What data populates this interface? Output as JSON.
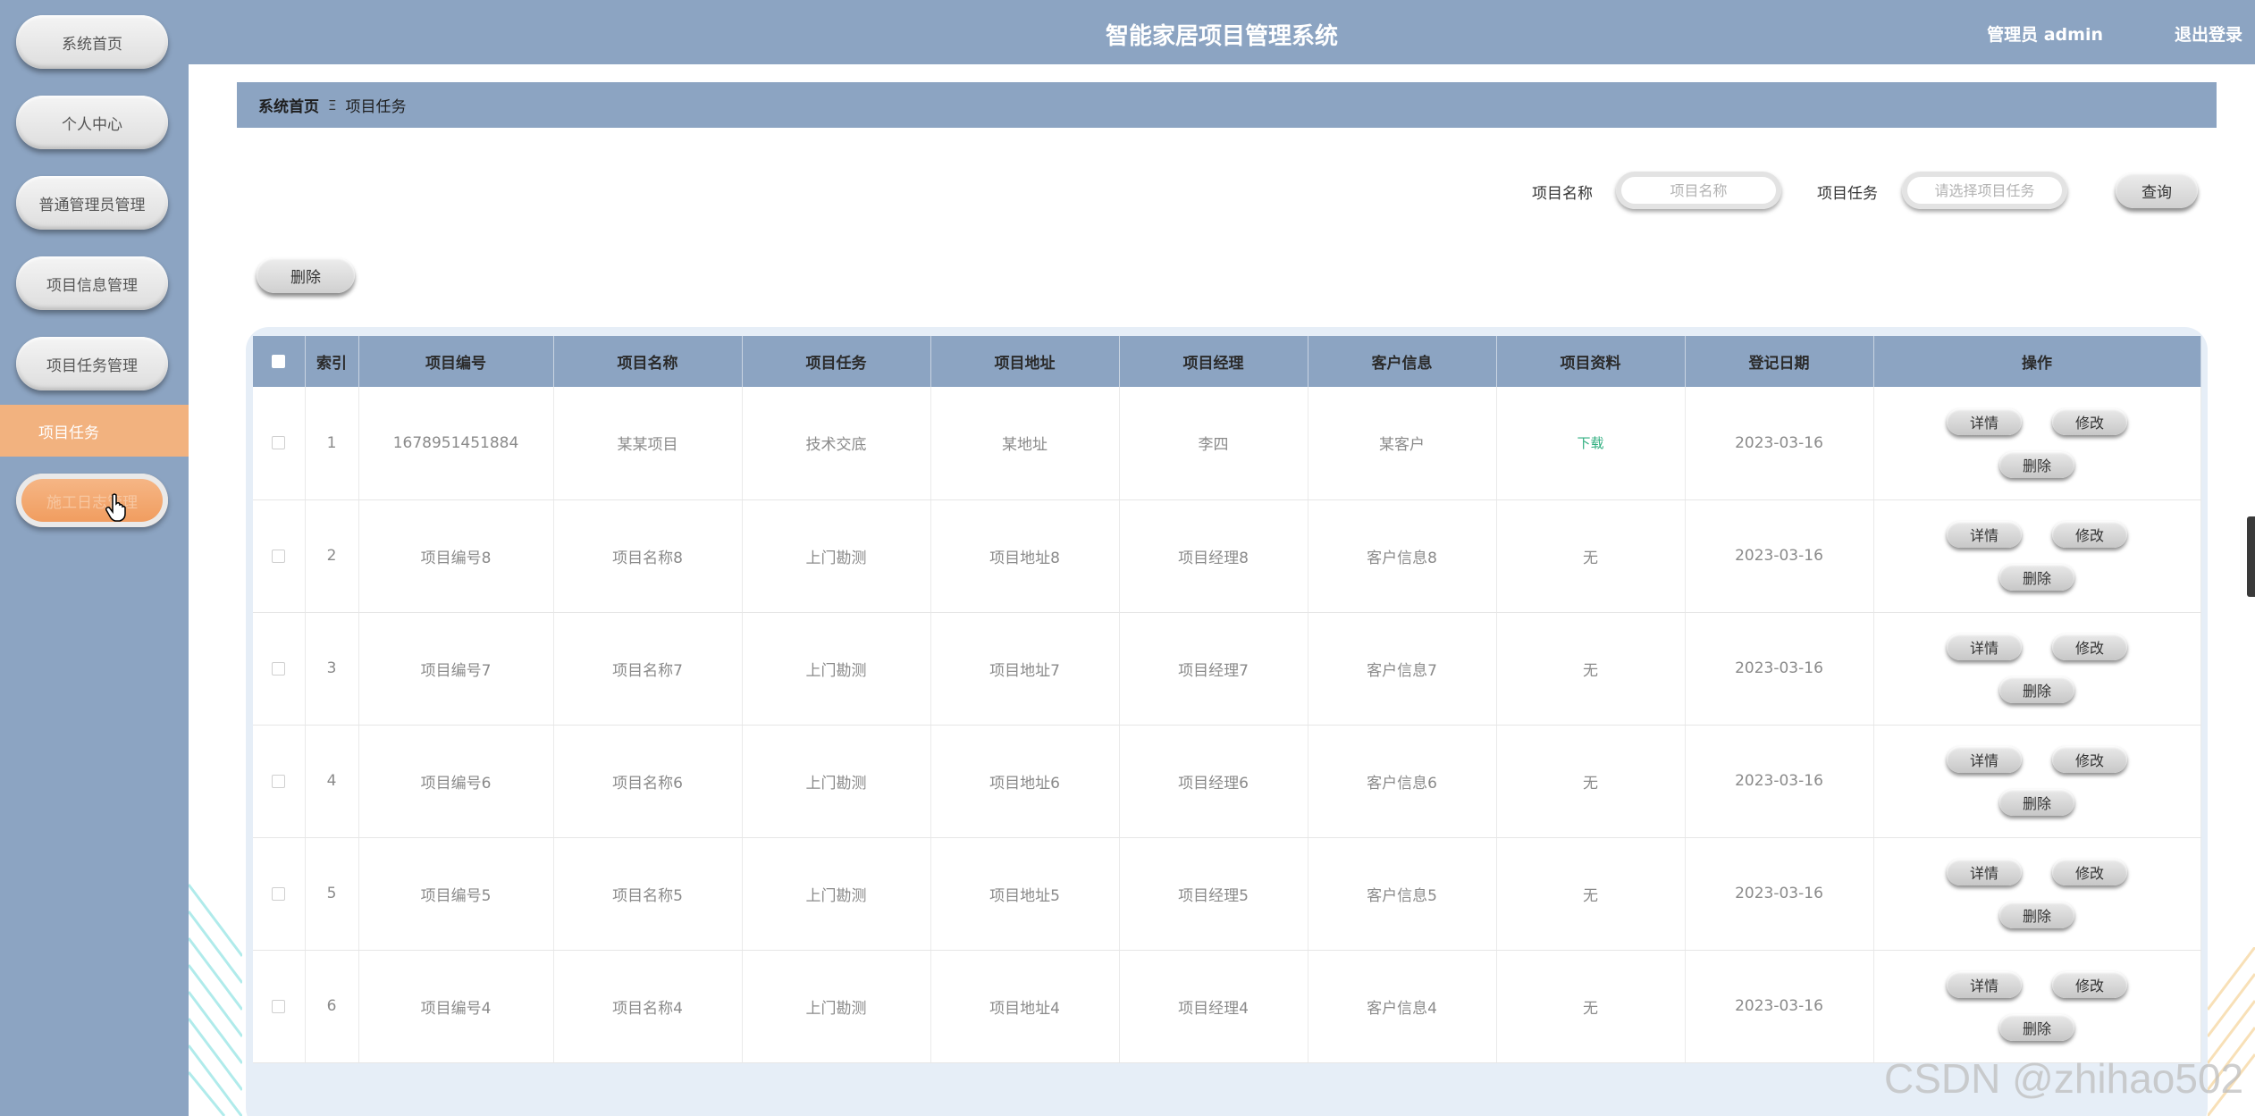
{
  "colors": {
    "primary": "#8ca4c2",
    "active": "#f2b27f",
    "download": "#2fae7f"
  },
  "sidebar": {
    "items": [
      {
        "label": "系统首页"
      },
      {
        "label": "个人中心"
      },
      {
        "label": "普通管理员管理"
      },
      {
        "label": "项目信息管理"
      },
      {
        "label": "项目任务管理"
      }
    ],
    "sub_item": "项目任务",
    "last_item": "施工日志管理"
  },
  "header": {
    "title": "智能家居项目管理系统",
    "user": "管理员 admin",
    "logout": "退出登录"
  },
  "breadcrumb": {
    "home": "系统首页",
    "separator": "Ξ",
    "current": "项目任务"
  },
  "search": {
    "name_label": "项目名称",
    "name_placeholder": "项目名称",
    "task_label": "项目任务",
    "task_placeholder": "请选择项目任务",
    "query_button": "查询"
  },
  "toolbar": {
    "delete_button": "删除"
  },
  "table": {
    "headers": [
      "索引",
      "项目编号",
      "项目名称",
      "项目任务",
      "项目地址",
      "项目经理",
      "客户信息",
      "项目资料",
      "登记日期",
      "操作"
    ],
    "rows": [
      {
        "index": "1",
        "code": "1678951451884",
        "name": "某某项目",
        "task": "技术交底",
        "address": "某地址",
        "manager": "李四",
        "client": "某客户",
        "material": "下载",
        "date": "2023-03-16"
      },
      {
        "index": "2",
        "code": "项目编号8",
        "name": "项目名称8",
        "task": "上门勘测",
        "address": "项目地址8",
        "manager": "项目经理8",
        "client": "客户信息8",
        "material": "无",
        "date": "2023-03-16"
      },
      {
        "index": "3",
        "code": "项目编号7",
        "name": "项目名称7",
        "task": "上门勘测",
        "address": "项目地址7",
        "manager": "项目经理7",
        "client": "客户信息7",
        "material": "无",
        "date": "2023-03-16"
      },
      {
        "index": "4",
        "code": "项目编号6",
        "name": "项目名称6",
        "task": "上门勘测",
        "address": "项目地址6",
        "manager": "项目经理6",
        "client": "客户信息6",
        "material": "无",
        "date": "2023-03-16"
      },
      {
        "index": "5",
        "code": "项目编号5",
        "name": "项目名称5",
        "task": "上门勘测",
        "address": "项目地址5",
        "manager": "项目经理5",
        "client": "客户信息5",
        "material": "无",
        "date": "2023-03-16"
      },
      {
        "index": "6",
        "code": "项目编号4",
        "name": "项目名称4",
        "task": "上门勘测",
        "address": "项目地址4",
        "manager": "项目经理4",
        "client": "客户信息4",
        "material": "无",
        "date": "2023-03-16"
      }
    ],
    "actions": {
      "detail": "详情",
      "edit": "修改",
      "delete": "删除"
    }
  },
  "watermark": "CSDN @zhihao502"
}
